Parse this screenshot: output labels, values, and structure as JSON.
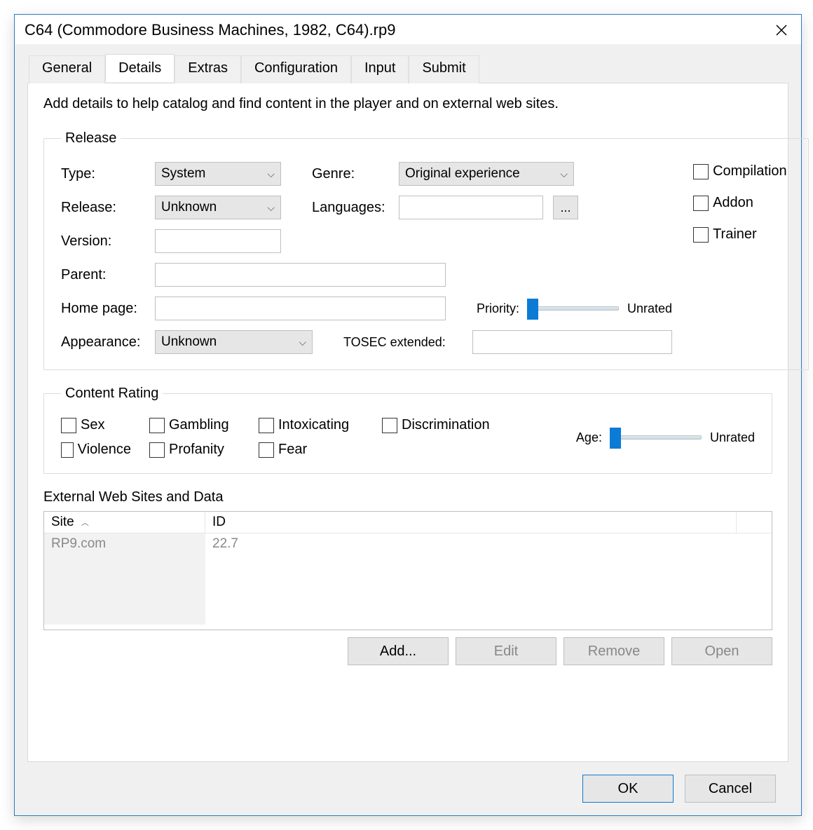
{
  "title": "C64 (Commodore Business Machines, 1982, C64).rp9",
  "tabs": [
    "General",
    "Details",
    "Extras",
    "Configuration",
    "Input",
    "Submit"
  ],
  "active_tab": "Details",
  "intro": "Add details to help catalog and find content in the player and on external web sites.",
  "release": {
    "legend": "Release",
    "type_label": "Type:",
    "type_value": "System",
    "genre_label": "Genre:",
    "genre_value": "Original experience",
    "release_label": "Release:",
    "release_value": "Unknown",
    "languages_label": "Languages:",
    "languages_value": "",
    "languages_button": "...",
    "version_label": "Version:",
    "version_value": "",
    "parent_label": "Parent:",
    "parent_value": "",
    "homepage_label": "Home page:",
    "homepage_value": "",
    "appearance_label": "Appearance:",
    "appearance_value": "Unknown",
    "tosec_label": "TOSEC extended:",
    "tosec_value": "",
    "priority_label": "Priority:",
    "priority_value": "Unrated",
    "checkboxes": {
      "compilation": "Compilation",
      "addon": "Addon",
      "trainer": "Trainer"
    }
  },
  "content_rating": {
    "legend": "Content Rating",
    "items": {
      "sex": "Sex",
      "gambling": "Gambling",
      "intoxicating": "Intoxicating",
      "discrimination": "Discrimination",
      "violence": "Violence",
      "profanity": "Profanity",
      "fear": "Fear"
    },
    "age_label": "Age:",
    "age_value": "Unrated"
  },
  "external": {
    "legend": "External Web Sites and Data",
    "col_site": "Site",
    "col_id": "ID",
    "rows": [
      {
        "site": "RP9.com",
        "id": "22.7"
      }
    ],
    "buttons": {
      "add": "Add...",
      "edit": "Edit",
      "remove": "Remove",
      "open": "Open"
    }
  },
  "footer": {
    "ok": "OK",
    "cancel": "Cancel"
  }
}
